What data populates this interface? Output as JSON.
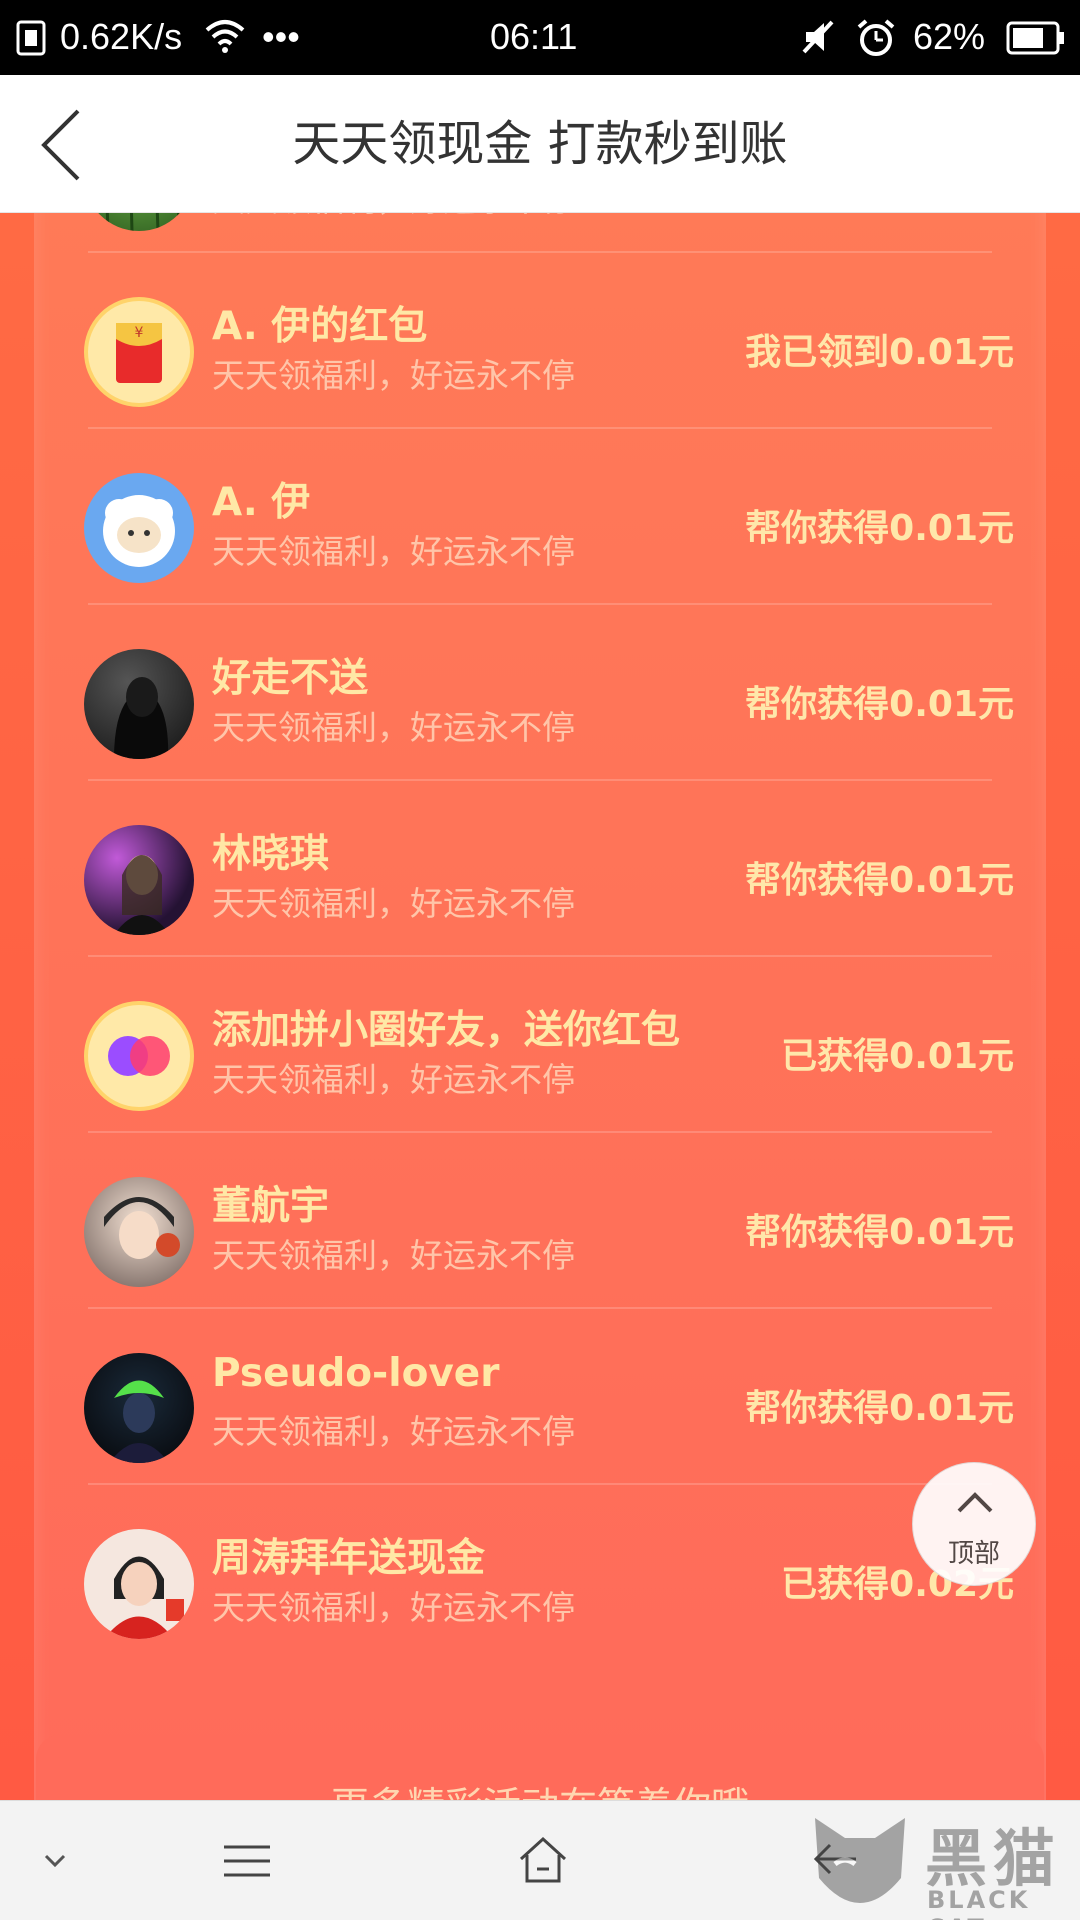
{
  "status_bar": {
    "speed": "0.62K/s",
    "dots": "•••",
    "time": "06:11",
    "battery": "62%"
  },
  "header": {
    "title": "天天领现金 打款秒到账"
  },
  "list": {
    "items": [
      {
        "name": "",
        "subtitle": "天天领福利，好运永不停",
        "status": "",
        "avatar": "bamboo-avatar"
      },
      {
        "name": "A. 伊的红包",
        "subtitle": "天天领福利，好运永不停",
        "status": "我已领到0.01元",
        "avatar": "red-envelope-icon"
      },
      {
        "name": "A. 伊",
        "subtitle": "天天领福利，好运永不停",
        "status": "帮你获得0.01元",
        "avatar": "sheep-avatar"
      },
      {
        "name": "好走不送",
        "subtitle": "天天领福利，好运永不停",
        "status": "帮你获得0.01元",
        "avatar": "dark-hood-avatar"
      },
      {
        "name": "林晓琪",
        "subtitle": "天天领福利，好运永不停",
        "status": "帮你获得0.01元",
        "avatar": "girl-neon-avatar"
      },
      {
        "name": "添加拼小圈好友，送你红包",
        "subtitle": "天天领福利，好运永不停",
        "status": "已获得0.01元",
        "avatar": "circles-icon"
      },
      {
        "name": "董航宇",
        "subtitle": "天天领福利，好运永不停",
        "status": "帮你获得0.01元",
        "avatar": "anime-boy-avatar"
      },
      {
        "name": "Pseudo-lover",
        "subtitle": "天天领福利，好运永不停",
        "status": "帮你获得0.01元",
        "avatar": "green-hair-avatar"
      },
      {
        "name": "周涛拜年送现金",
        "subtitle": "天天领福利，好运永不停",
        "status": "已获得0.02元",
        "avatar": "woman-new-year-avatar"
      }
    ]
  },
  "promo": {
    "text": "更多精彩活动在等着你哦"
  },
  "back_to_top": {
    "label": "顶部"
  },
  "watermark": {
    "cn": "黑猫",
    "en": "BLACK CAT"
  },
  "colors": {
    "accent_gold": "#ffe7aa",
    "background": "#ff6a44"
  }
}
